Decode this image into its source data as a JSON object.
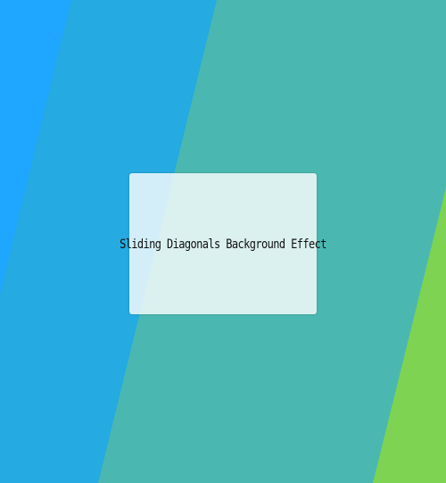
{
  "content": {
    "title": "Sliding Diagonals Background Effect"
  },
  "colors": {
    "blue": "#1fa6ff",
    "mid_blue": "#25aae1",
    "teal": "#4ab8b1",
    "green": "#7ed352",
    "card_background": "#ffffff"
  }
}
